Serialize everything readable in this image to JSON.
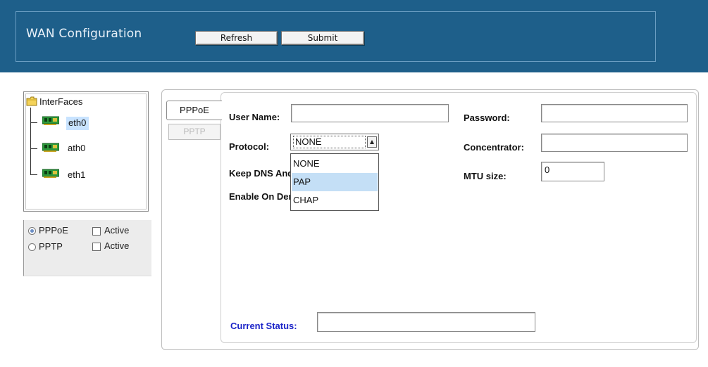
{
  "header": {
    "title": "WAN Configuration",
    "refresh_label": "Refresh",
    "submit_label": "Submit"
  },
  "tree": {
    "root_label": "InterFaces",
    "items": [
      {
        "label": "eth0",
        "selected": true
      },
      {
        "label": "ath0",
        "selected": false
      },
      {
        "label": "eth1",
        "selected": false
      }
    ]
  },
  "modes": [
    {
      "label": "PPPoE",
      "selected": true,
      "active_label": "Active",
      "active_checked": false
    },
    {
      "label": "PPTP",
      "selected": false,
      "active_label": "Active",
      "active_checked": false
    }
  ],
  "tabs": [
    {
      "label": "PPPoE",
      "active": true
    },
    {
      "label": "PPTP",
      "active": false
    }
  ],
  "form": {
    "user_name_label": "User Name:",
    "user_name_value": "",
    "password_label": "Password:",
    "password_value": "",
    "protocol_label": "Protocol:",
    "protocol_value": "NONE",
    "protocol_options": [
      "NONE",
      "PAP",
      "CHAP"
    ],
    "protocol_highlighted": "PAP",
    "concentrator_label": "Concentrator:",
    "concentrator_value": "",
    "keep_dns_label": "Keep DNS And",
    "mtu_label": "MTU size:",
    "mtu_value": "0",
    "enable_on_demand_label": "Enable On Demand",
    "current_status_label": "Current Status:",
    "current_status_value": ""
  },
  "colors": {
    "header_bg": "#1e5f8a",
    "status_label": "#1a23c8",
    "selection_bg": "#c4dff6"
  }
}
